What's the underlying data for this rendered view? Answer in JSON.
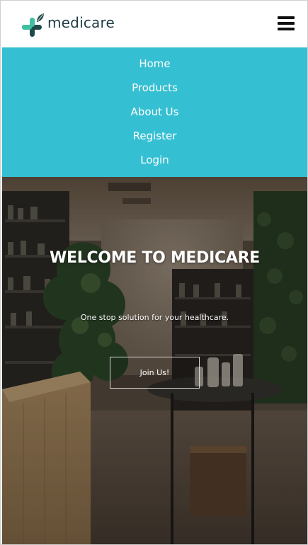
{
  "brand": {
    "name": "medicare",
    "logo_icon": "medical-cross-leaf-icon",
    "colors": {
      "teal": "#35bfd2",
      "dark_green": "#1f4a4a",
      "text": "#1f3b46"
    }
  },
  "header": {
    "menu_icon": "hamburger-menu-icon"
  },
  "nav": {
    "items": [
      {
        "label": "Home"
      },
      {
        "label": "Products"
      },
      {
        "label": "About Us"
      },
      {
        "label": "Register"
      },
      {
        "label": "Login"
      }
    ]
  },
  "hero": {
    "title": "WELCOME TO MEDICARE",
    "subtitle": "One stop solution for your healthcare.",
    "button_label": "Join Us!"
  }
}
